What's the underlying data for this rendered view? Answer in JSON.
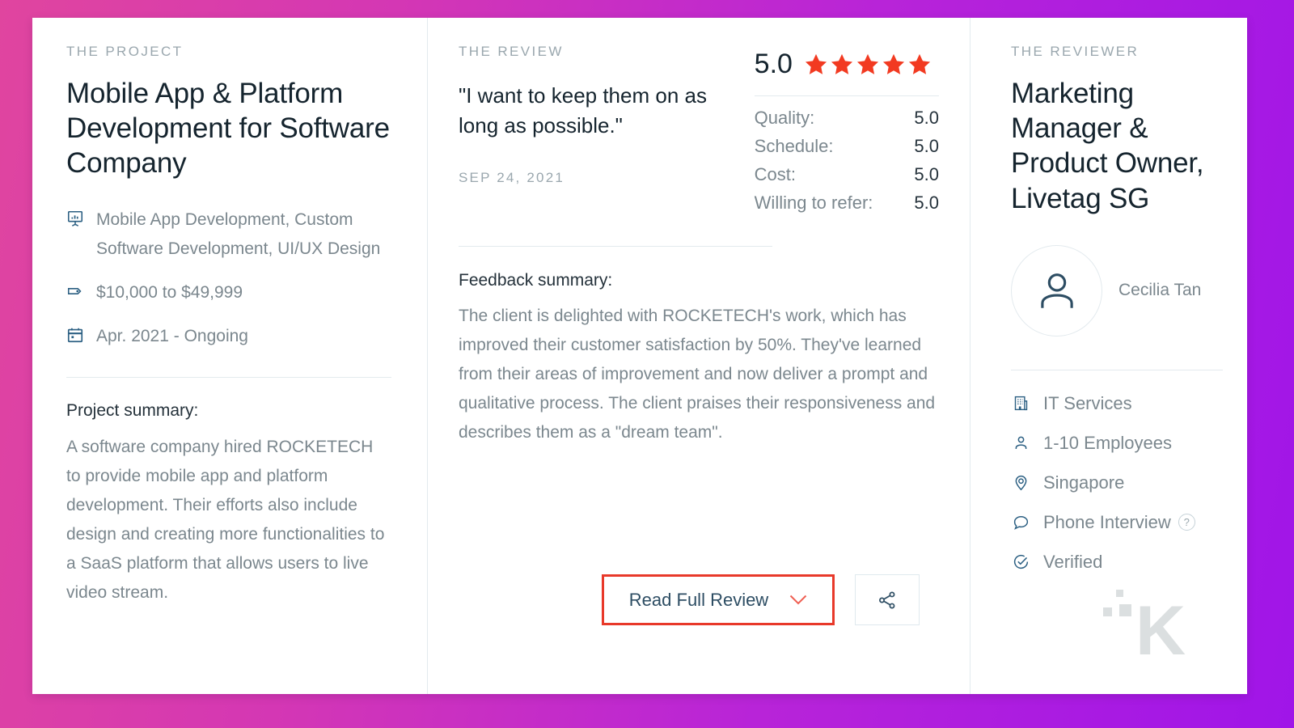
{
  "theme": {
    "gradient_start": "#e0459f",
    "gradient_end": "#a015e8",
    "card_bg": "#ffffff",
    "star_color": "#f23a21",
    "accent_icon": "#2b5f82",
    "heading_color": "#15242e",
    "body_color": "#7b878e",
    "highlight_border": "#e8392a",
    "chevron_color": "#ef5f52",
    "divider_color": "#e3eaee"
  },
  "project": {
    "eyebrow": "THE PROJECT",
    "title": "Mobile App & Platform Development for Software Company",
    "meta": [
      {
        "icon": "presentation-board-icon",
        "text": "Mobile App Development, Custom Software Development, UI/UX Design"
      },
      {
        "icon": "price-tag-icon",
        "text": "$10,000 to $49,999"
      },
      {
        "icon": "calendar-icon",
        "text": "Apr. 2021 - Ongoing"
      }
    ],
    "summary_title": "Project summary:",
    "summary_body": "A software company hired ROCKETECH to provide mobile app and platform development. Their efforts also include design and creating more functionalities to a SaaS platform that allows users to live video stream."
  },
  "review": {
    "eyebrow": "THE REVIEW",
    "quote": "\"I want to keep them on as long as possible.\"",
    "date": "SEP 24, 2021",
    "rating": {
      "overall": "5.0",
      "stars": 5,
      "breakdown": [
        {
          "label": "Quality:",
          "value": "5.0"
        },
        {
          "label": "Schedule:",
          "value": "5.0"
        },
        {
          "label": "Cost:",
          "value": "5.0"
        },
        {
          "label": "Willing to refer:",
          "value": "5.0"
        }
      ]
    },
    "feedback_title": "Feedback summary:",
    "feedback_body": "The client is delighted with ROCKETECH's work, which has improved their customer satisfaction by 50%. They've learned from their areas of improvement and now deliver a prompt and qualitative process. The client praises their responsiveness and describes them as a \"dream team\".",
    "actions": {
      "read_full_review": "Read Full Review",
      "share_icon": "share-icon",
      "chevron_icon": "chevron-down-icon"
    }
  },
  "reviewer": {
    "eyebrow": "THE REVIEWER",
    "title": "Marketing Manager & Product Owner, Livetag SG",
    "avatar_icon": "person-avatar-icon",
    "name": "Cecilia Tan",
    "meta": [
      {
        "icon": "building-icon",
        "text": "IT Services",
        "help": null
      },
      {
        "icon": "person-icon",
        "text": "1-10 Employees",
        "help": null
      },
      {
        "icon": "location-pin-icon",
        "text": "Singapore",
        "help": null
      },
      {
        "icon": "speech-bubble-icon",
        "text": "Phone Interview",
        "help": "?"
      },
      {
        "icon": "check-circle-icon",
        "text": "Verified",
        "help": null
      }
    ]
  },
  "watermark": {
    "letter": "K"
  }
}
